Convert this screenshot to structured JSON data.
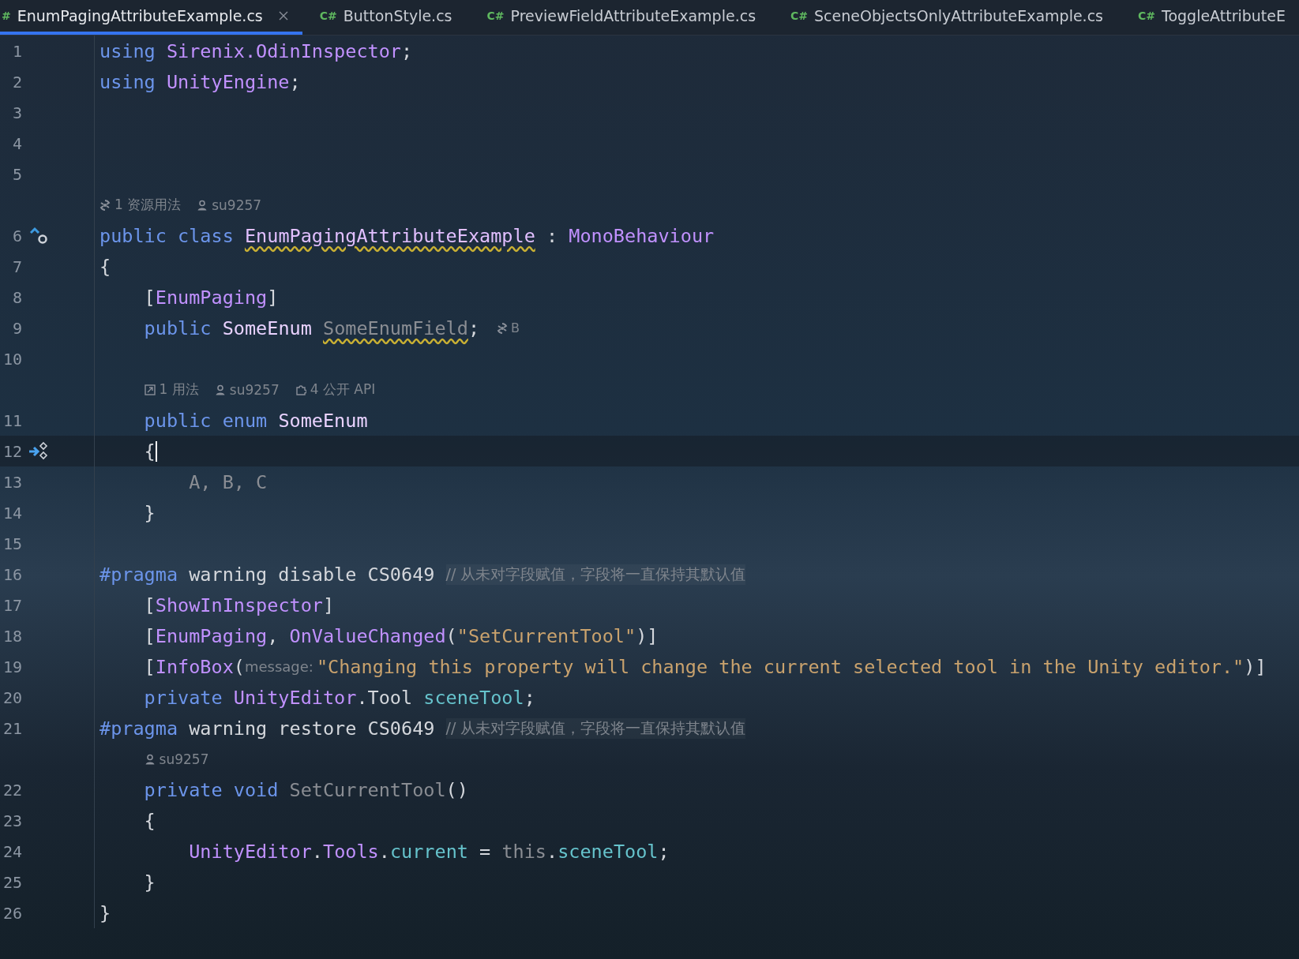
{
  "tabs": [
    {
      "lang": "#",
      "label": "EnumPagingAttributeExample.cs",
      "selected": true
    },
    {
      "lang": "C#",
      "label": "ButtonStyle.cs",
      "selected": false
    },
    {
      "lang": "C#",
      "label": "PreviewFieldAttributeExample.cs",
      "selected": false
    },
    {
      "lang": "C#",
      "label": "SceneObjectsOnlyAttributeExample.cs",
      "selected": false
    },
    {
      "lang": "C#",
      "label": "ToggleAttributeE",
      "selected": false
    }
  ],
  "rows": [
    {
      "kind": "code",
      "number": "1",
      "tokens": [
        {
          "t": "using ",
          "kind": "kw"
        },
        {
          "t": "Sirenix.OdinInspector",
          "kind": "ns"
        },
        {
          "t": ";",
          "kind": "plain"
        }
      ]
    },
    {
      "kind": "code",
      "number": "2",
      "tokens": [
        {
          "t": "using ",
          "kind": "kw"
        },
        {
          "t": "UnityEngine",
          "kind": "ns"
        },
        {
          "t": ";",
          "kind": "plain"
        }
      ]
    },
    {
      "kind": "code",
      "number": "3",
      "tokens": []
    },
    {
      "kind": "code",
      "number": "4",
      "tokens": []
    },
    {
      "kind": "code",
      "number": "5",
      "tokens": []
    },
    {
      "kind": "hint",
      "items": [
        {
          "kind": "usage",
          "text": "1 资源用法"
        },
        {
          "kind": "person",
          "text": "su9257"
        }
      ]
    },
    {
      "kind": "code",
      "number": "6",
      "gutter": {
        "kind": "inherit"
      },
      "tokens": [
        {
          "t": "public class ",
          "kind": "kw"
        },
        {
          "t": "EnumPagingAttributeExample",
          "kind": "cls",
          "warn": true
        },
        {
          "t": " : ",
          "kind": "plain"
        },
        {
          "t": "MonoBehaviour",
          "kind": "ns"
        }
      ]
    },
    {
      "kind": "code",
      "number": "7",
      "tokens": [
        {
          "t": "{",
          "kind": "plain"
        }
      ]
    },
    {
      "kind": "code",
      "number": "8",
      "tokens": [
        {
          "t": "    [",
          "kind": "plain"
        },
        {
          "t": "EnumPaging",
          "kind": "ns"
        },
        {
          "t": "]",
          "kind": "plain"
        }
      ]
    },
    {
      "kind": "code",
      "number": "9",
      "tokens": [
        {
          "t": "    public ",
          "kind": "kw"
        },
        {
          "t": "SomeEnum ",
          "kind": "enum"
        },
        {
          "t": "SomeEnumField",
          "kind": "dim",
          "warn": true
        },
        {
          "t": ";",
          "kind": "plain"
        }
      ],
      "inlay": {
        "kind": "usage",
        "text": "B"
      }
    },
    {
      "kind": "code",
      "number": "10",
      "tokens": []
    },
    {
      "kind": "hint",
      "items": [
        {
          "kind": "link",
          "text": "1 用法"
        },
        {
          "kind": "person",
          "text": "su9257"
        },
        {
          "kind": "puzzle",
          "text": "4 公开 API"
        }
      ]
    },
    {
      "kind": "code",
      "number": "11",
      "tokens": [
        {
          "t": "    public enum ",
          "kind": "kw"
        },
        {
          "t": "SomeEnum",
          "kind": "enum"
        }
      ]
    },
    {
      "kind": "code",
      "number": "12",
      "gutter": {
        "kind": "run"
      },
      "current": true,
      "tokens": [
        {
          "t": "    {",
          "kind": "plain"
        }
      ]
    },
    {
      "kind": "code",
      "number": "13",
      "current": false,
      "tokens": [
        {
          "t": "        A, B, C",
          "kind": "dim"
        }
      ]
    },
    {
      "kind": "code",
      "number": "14",
      "tokens": [
        {
          "t": "    }",
          "kind": "plain"
        }
      ]
    },
    {
      "kind": "code",
      "number": "15",
      "tokens": []
    },
    {
      "kind": "code",
      "number": "16",
      "tokens": [
        {
          "t": "#pragma ",
          "kind": "kw"
        },
        {
          "t": "warning disable CS0649 ",
          "kind": "plain"
        },
        {
          "t": "// 从未对字段赋值，字段将一直保持其默认值",
          "kind": "cm"
        }
      ]
    },
    {
      "kind": "code",
      "number": "17",
      "tokens": [
        {
          "t": "    [",
          "kind": "plain"
        },
        {
          "t": "ShowInInspector",
          "kind": "ns"
        },
        {
          "t": "]",
          "kind": "plain"
        }
      ]
    },
    {
      "kind": "code",
      "number": "18",
      "tokens": [
        {
          "t": "    [",
          "kind": "plain"
        },
        {
          "t": "EnumPaging",
          "kind": "ns"
        },
        {
          "t": ", ",
          "kind": "plain"
        },
        {
          "t": "OnValueChanged",
          "kind": "ns"
        },
        {
          "t": "(",
          "kind": "plain"
        },
        {
          "t": "\"SetCurrentTool\"",
          "kind": "str"
        },
        {
          "t": ")]",
          "kind": "plain"
        }
      ]
    },
    {
      "kind": "code",
      "number": "19",
      "tokens": [
        {
          "t": "    [",
          "kind": "plain"
        },
        {
          "t": "InfoBox",
          "kind": "ns"
        },
        {
          "t": "(",
          "kind": "plain"
        },
        {
          "t": "message:",
          "kind": "param"
        },
        {
          "t": "\"Changing this property will change the current selected tool in the Unity editor.\"",
          "kind": "str"
        },
        {
          "t": ")]",
          "kind": "plain"
        }
      ]
    },
    {
      "kind": "code",
      "number": "20",
      "tokens": [
        {
          "t": "    private ",
          "kind": "kw"
        },
        {
          "t": "UnityEditor",
          "kind": "ns"
        },
        {
          "t": ".Tool ",
          "kind": "plain"
        },
        {
          "t": "sceneTool",
          "kind": "field"
        },
        {
          "t": ";",
          "kind": "plain"
        }
      ]
    },
    {
      "kind": "code",
      "number": "21",
      "tokens": [
        {
          "t": "#pragma ",
          "kind": "kw"
        },
        {
          "t": "warning restore CS0649 ",
          "kind": "plain"
        },
        {
          "t": "// 从未对字段赋值，字段将一直保持其默认值",
          "kind": "cm"
        }
      ]
    },
    {
      "kind": "hint",
      "items": [
        {
          "kind": "person",
          "text": "su9257"
        }
      ]
    },
    {
      "kind": "code",
      "number": "22",
      "tokens": [
        {
          "t": "    private void ",
          "kind": "kw"
        },
        {
          "t": "SetCurrentTool",
          "kind": "dim"
        },
        {
          "t": "()",
          "kind": "plain"
        }
      ]
    },
    {
      "kind": "code",
      "number": "23",
      "tokens": [
        {
          "t": "    {",
          "kind": "plain"
        }
      ]
    },
    {
      "kind": "code",
      "number": "24",
      "tokens": [
        {
          "t": "        UnityEditor",
          "kind": "ns"
        },
        {
          "t": ".",
          "kind": "plain"
        },
        {
          "t": "Tools",
          "kind": "ns"
        },
        {
          "t": ".",
          "kind": "plain"
        },
        {
          "t": "current",
          "kind": "field"
        },
        {
          "t": " = ",
          "kind": "plain"
        },
        {
          "t": "this",
          "kind": "dim"
        },
        {
          "t": ".",
          "kind": "plain"
        },
        {
          "t": "sceneTool",
          "kind": "field"
        },
        {
          "t": ";",
          "kind": "plain"
        }
      ]
    },
    {
      "kind": "code",
      "number": "25",
      "tokens": [
        {
          "t": "    }",
          "kind": "plain"
        }
      ]
    },
    {
      "kind": "code",
      "number": "26",
      "tokens": [
        {
          "t": "}",
          "kind": "plain"
        }
      ]
    }
  ]
}
